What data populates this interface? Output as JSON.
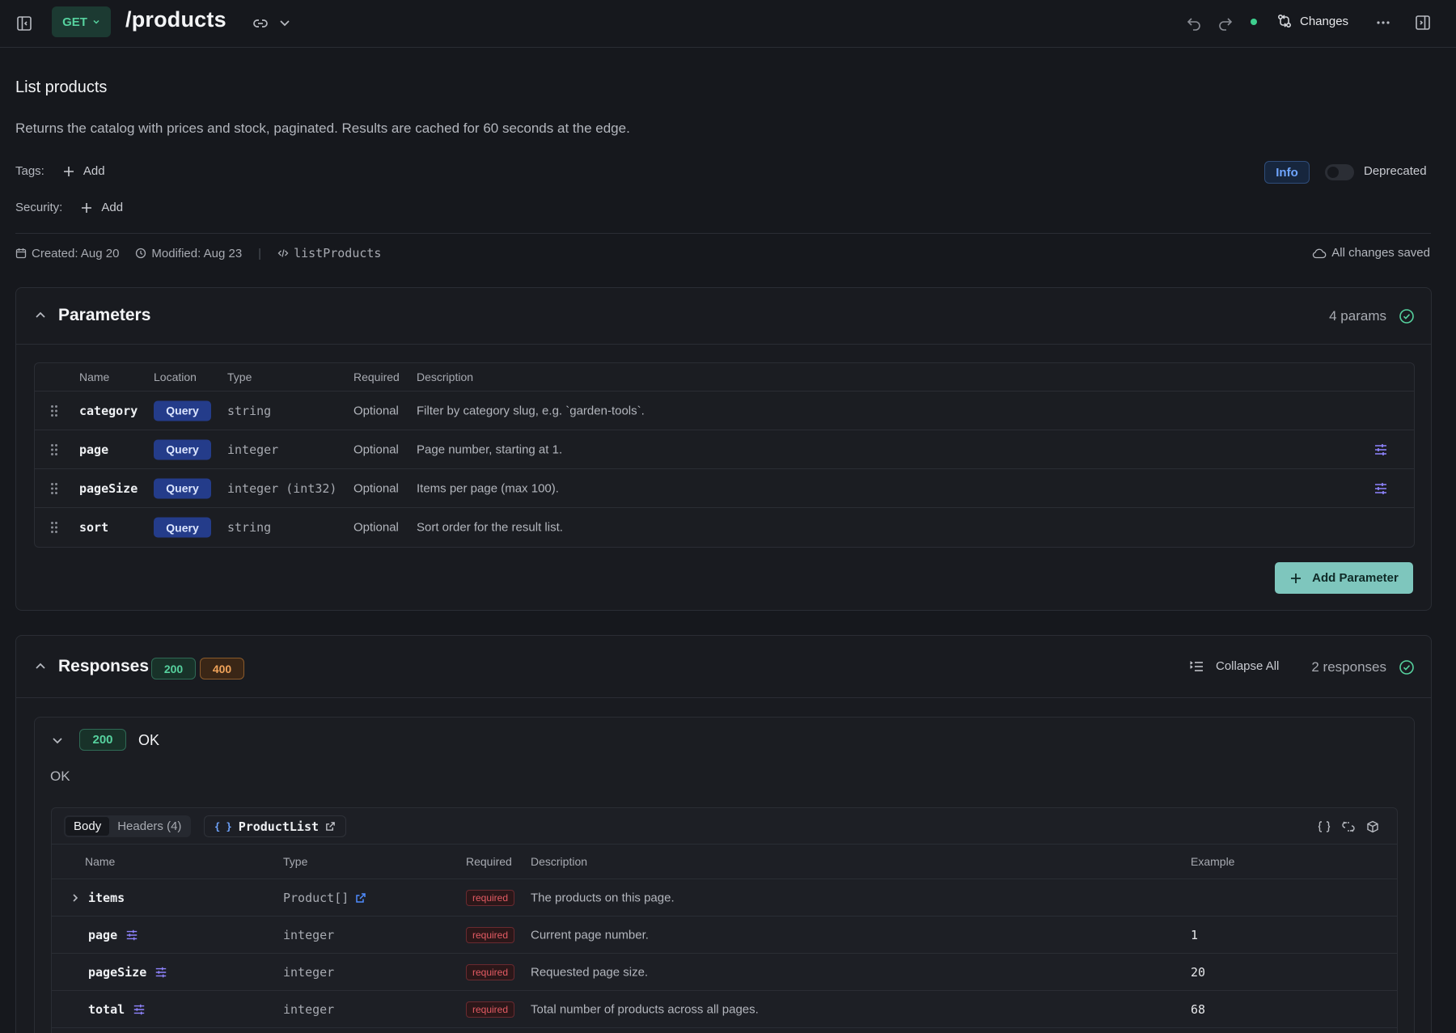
{
  "topbar": {
    "method": "GET",
    "path": "/products",
    "changes_label": "Changes"
  },
  "operation": {
    "title": "List products",
    "description": "Returns the catalog with prices and stock, paginated. Results are cached for 60 seconds at the edge.",
    "tags_label": "Tags:",
    "security_label": "Security:",
    "add_label": "Add",
    "info_badge": "Info",
    "deprecated_label": "Deprecated",
    "created": "Created: Aug 20",
    "modified": "Modified: Aug 23",
    "operation_id": "listProducts",
    "saved_status": "All changes saved"
  },
  "parameters": {
    "title": "Parameters",
    "count": "4 params",
    "columns": [
      "Name",
      "Location",
      "Type",
      "Required",
      "Description"
    ],
    "rows": [
      {
        "name": "category",
        "location": "Query",
        "type": "string",
        "required": "Optional",
        "description": "Filter by category slug, e.g. `garden-tools`."
      },
      {
        "name": "page",
        "location": "Query",
        "type": "integer",
        "required": "Optional",
        "description": "Page number, starting at 1."
      },
      {
        "name": "pageSize",
        "location": "Query",
        "type": "integer (int32)",
        "required": "Optional",
        "description": "Items per page (max 100)."
      },
      {
        "name": "sort",
        "location": "Query",
        "type": "string",
        "required": "Optional",
        "description": "Sort order for the result list."
      }
    ],
    "add_button": "Add Parameter"
  },
  "responses": {
    "title": "Responses",
    "codes": [
      "200",
      "400"
    ],
    "collapse_all": "Collapse All",
    "count": "2 responses",
    "card": {
      "code": "200",
      "status_text": "OK",
      "description": "OK",
      "tabs": [
        "Body",
        "Headers (4)"
      ],
      "schema_name": "ProductList",
      "columns": [
        "Name",
        "Type",
        "Required",
        "Description",
        "Example"
      ],
      "rows": [
        {
          "name": "items",
          "type": "Product[]",
          "required": "required",
          "description": "The products on this page.",
          "example": ""
        },
        {
          "name": "page",
          "type": "integer",
          "required": "required",
          "description": "Current page number.",
          "example": "1"
        },
        {
          "name": "pageSize",
          "type": "integer",
          "required": "required",
          "description": "Requested page size.",
          "example": "20"
        },
        {
          "name": "total",
          "type": "integer",
          "required": "required",
          "description": "Total number of products across all pages.",
          "example": "68"
        }
      ]
    }
  },
  "colors": {
    "background": "#16181d",
    "get_method": "#56d19e",
    "query_badge": "#243c8a",
    "add_parameter_button": "#7ec6bd",
    "code_200": "#56d19e",
    "code_400": "#f0a35a",
    "required_badge": "#e35b63"
  }
}
